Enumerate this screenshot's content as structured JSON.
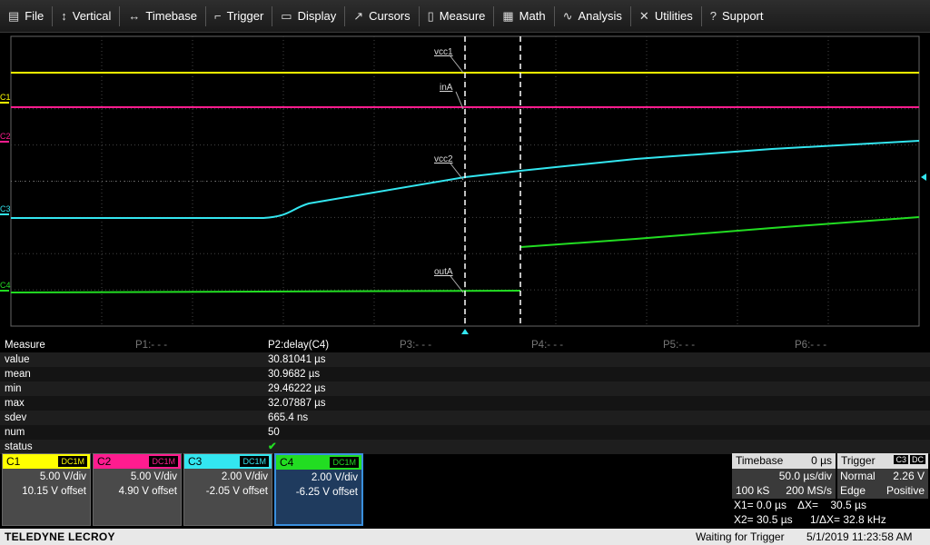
{
  "menu": [
    {
      "icon": "file-icon",
      "glyph": "▤",
      "label": "File"
    },
    {
      "icon": "vertical-icon",
      "glyph": "↕",
      "label": "Vertical"
    },
    {
      "icon": "timebase-icon",
      "glyph": "↔",
      "label": "Timebase"
    },
    {
      "icon": "trigger-icon",
      "glyph": "⌐",
      "label": "Trigger"
    },
    {
      "icon": "display-icon",
      "glyph": "▭",
      "label": "Display"
    },
    {
      "icon": "cursors-icon",
      "glyph": "↗",
      "label": "Cursors"
    },
    {
      "icon": "measure-icon",
      "glyph": "▯",
      "label": "Measure"
    },
    {
      "icon": "math-icon",
      "glyph": "▦",
      "label": "Math"
    },
    {
      "icon": "analysis-icon",
      "glyph": "∿",
      "label": "Analysis"
    },
    {
      "icon": "utilities-icon",
      "glyph": "✕",
      "label": "Utilities"
    },
    {
      "icon": "support-icon",
      "glyph": "?",
      "label": "Support"
    }
  ],
  "channel_markers": {
    "c1": "C1",
    "c2": "C2",
    "c3": "C3",
    "c4": "C4"
  },
  "trace_labels": {
    "vcc1": "vcc1",
    "inA": "inA",
    "vcc2": "vcc2",
    "outA": "outA"
  },
  "colors": {
    "c1": "#ffff00",
    "c2": "#ff1c8f",
    "c3": "#33e6f0",
    "c4": "#22dd22",
    "grid": "#555555"
  },
  "measure": {
    "header": {
      "label": "Measure",
      "p1": "P1:- - -",
      "p2": "P2:delay(C4)",
      "p3": "P3:- - -",
      "p4": "P4:- - -",
      "p5": "P5:- - -",
      "p6": "P6:- - -"
    },
    "rows": [
      {
        "label": "value",
        "val": "30.81041 µs"
      },
      {
        "label": "mean",
        "val": "30.9682 µs"
      },
      {
        "label": "min",
        "val": "29.46222 µs"
      },
      {
        "label": "max",
        "val": "32.07887 µs"
      },
      {
        "label": "sdev",
        "val": "665.4 ns"
      },
      {
        "label": "num",
        "val": "50"
      },
      {
        "label": "status",
        "val": "✔"
      }
    ]
  },
  "channels": [
    {
      "name": "C1",
      "coupling": "DC1M",
      "vdiv": "5.00 V/div",
      "offset": "10.15 V offset",
      "color": "#ffff00"
    },
    {
      "name": "C2",
      "coupling": "DC1M",
      "vdiv": "5.00 V/div",
      "offset": "4.90 V offset",
      "color": "#ff1c8f"
    },
    {
      "name": "C3",
      "coupling": "DC1M",
      "vdiv": "2.00 V/div",
      "offset": "-2.05 V offset",
      "color": "#33e6f0"
    },
    {
      "name": "C4",
      "coupling": "DC1M",
      "vdiv": "2.00 V/div",
      "offset": "-6.25 V offset",
      "color": "#22dd22"
    }
  ],
  "timebase": {
    "title": "Timebase",
    "delay": "0 µs",
    "tdiv": "50.0 µs/div",
    "samples": "100 kS",
    "rate": "200 MS/s"
  },
  "trigger": {
    "title": "Trigger",
    "source": "C3",
    "coupling": "DC",
    "mode": "Normal",
    "level": "2.26 V",
    "type": "Edge",
    "slope": "Positive"
  },
  "cursors": {
    "x1": "X1= 0.0 µs",
    "dx": "ΔX=    30.5 µs",
    "x2": "X2= 30.5 µs",
    "inv": "1/ΔX= 32.8 kHz"
  },
  "status": {
    "brand": "TELEDYNE LECROY",
    "state": "Waiting for Trigger",
    "datetime": "5/1/2019 11:23:58 AM"
  }
}
